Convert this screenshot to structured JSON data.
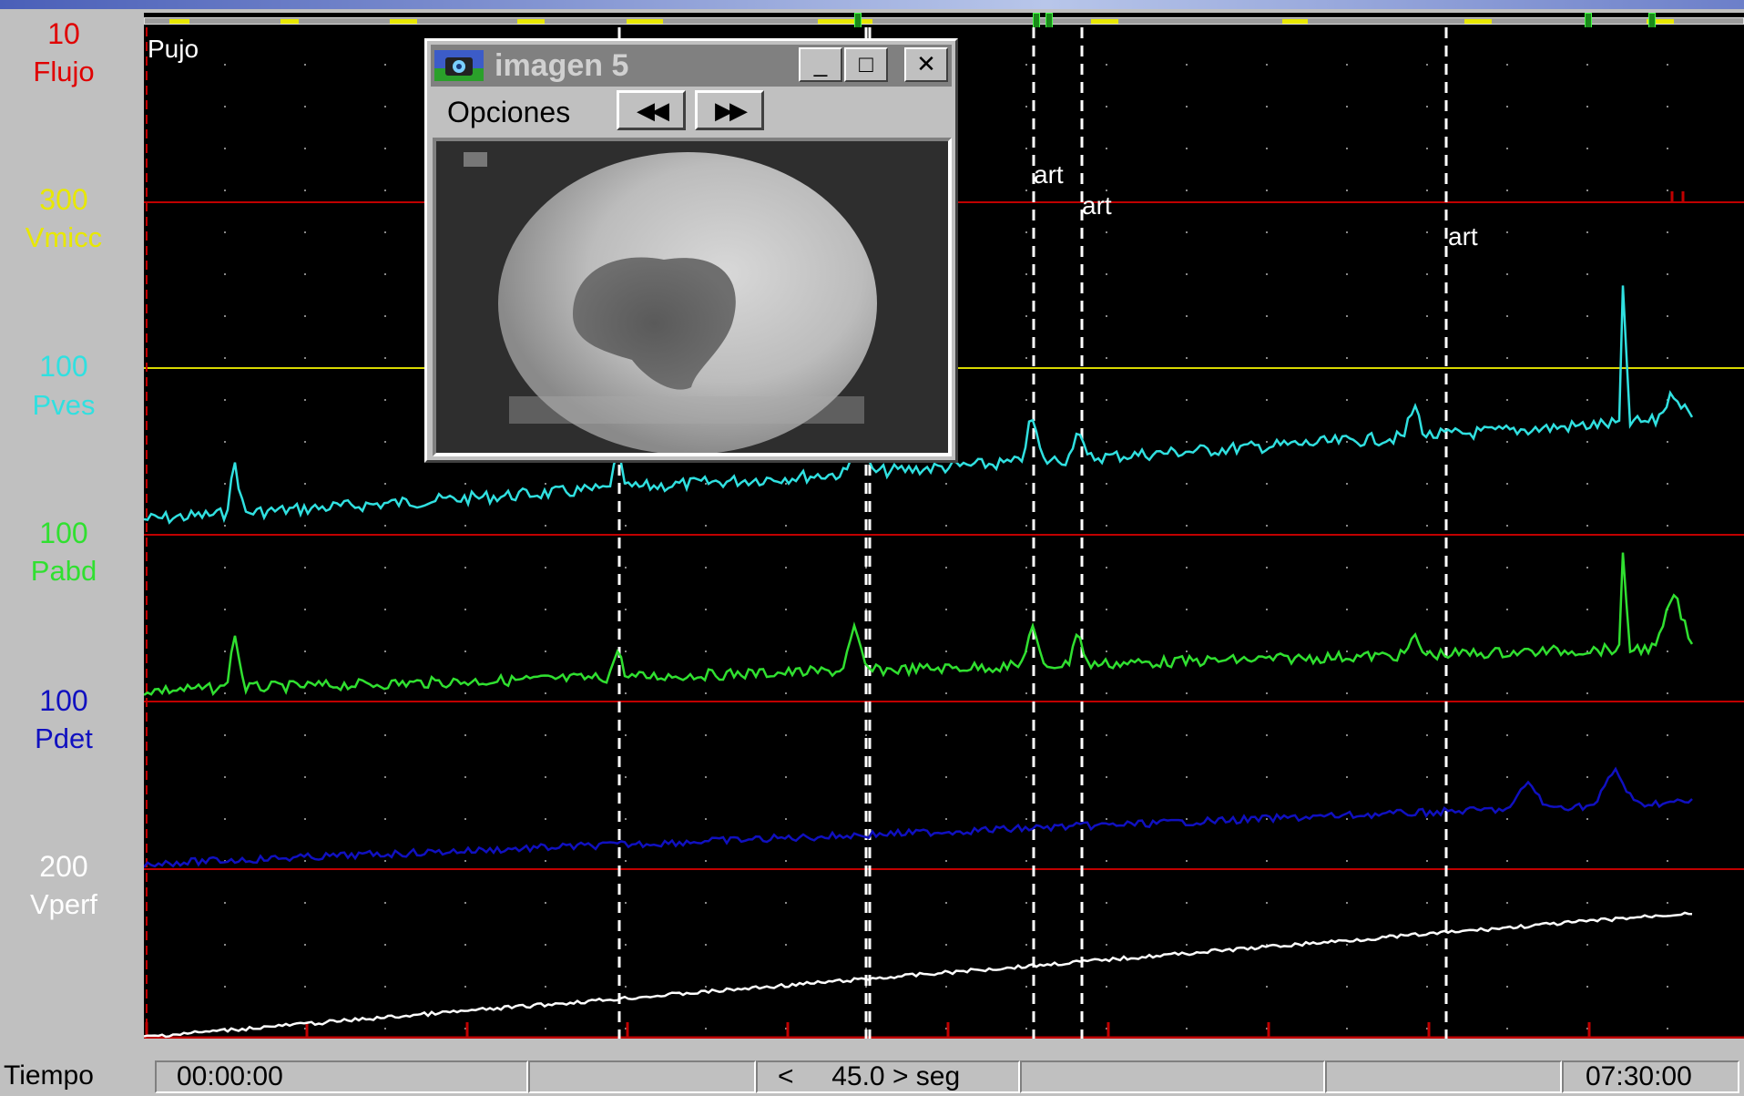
{
  "channels": [
    {
      "scale": "10",
      "name": "Flujo",
      "color": "#e00000"
    },
    {
      "scale": "300",
      "name": "Vmicc",
      "color": "#e8e800"
    },
    {
      "scale": "100",
      "name": "Pves",
      "color": "#30e0e0"
    },
    {
      "scale": "100",
      "name": "Pabd",
      "color": "#30e030"
    },
    {
      "scale": "100",
      "name": "Pdet",
      "color": "#1010c0"
    },
    {
      "scale": "200",
      "name": "Vperf",
      "color": "#ffffff"
    }
  ],
  "plot": {
    "pujo_label": "Pujo",
    "art_labels": [
      "art",
      "art",
      "art"
    ]
  },
  "window": {
    "title": "imagen 5",
    "minimize": "_",
    "maximize": "□",
    "close": "✕",
    "menu_opciones": "Opciones",
    "rewind": "◀◀",
    "forward": "▶▶",
    "icon": "camera-icon"
  },
  "status": {
    "tiempo": "Tiempo",
    "start_time": "00:00:00",
    "speed_prev": "<",
    "speed_value": "45.0",
    "speed_unit": "> seg",
    "end_time": "07:30:00"
  }
}
